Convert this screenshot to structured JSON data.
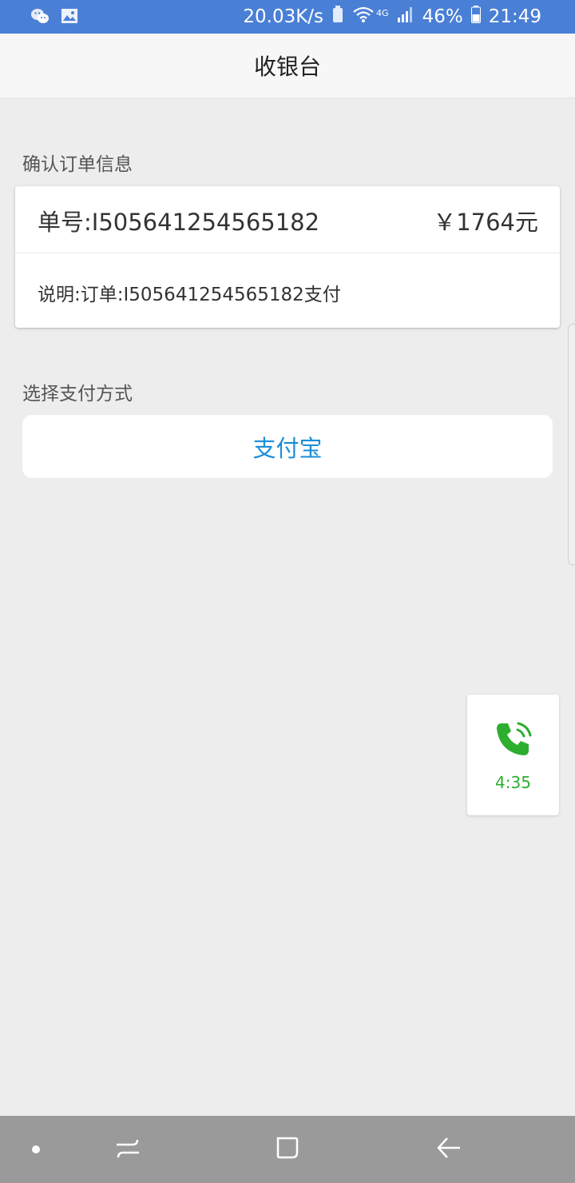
{
  "status_bar": {
    "speed": "20.03K/s",
    "network": "4G",
    "battery": "46%",
    "time": "21:49",
    "icons": [
      "wechat-icon",
      "image-icon",
      "recycle-icon",
      "wifi-icon",
      "signal-icon",
      "battery-icon"
    ]
  },
  "header": {
    "title": "收银台"
  },
  "order_section": {
    "label": "确认订单信息",
    "order_number": "单号:I505641254565182",
    "amount": "￥1764元",
    "description": "说明:订单:I505641254565182支付"
  },
  "payment_section": {
    "label": "选择支付方式",
    "alipay_label": "支付宝"
  },
  "call_widget": {
    "duration": "4:35",
    "icon": "phone-call-icon",
    "color": "#2eae2e"
  },
  "nav_bar": {
    "icons": [
      "dot-icon",
      "recent-apps-icon",
      "home-icon",
      "back-icon"
    ]
  },
  "colors": {
    "status_bar": "#4a7fd6",
    "accent": "#1a8fd8",
    "background": "#ededed"
  }
}
